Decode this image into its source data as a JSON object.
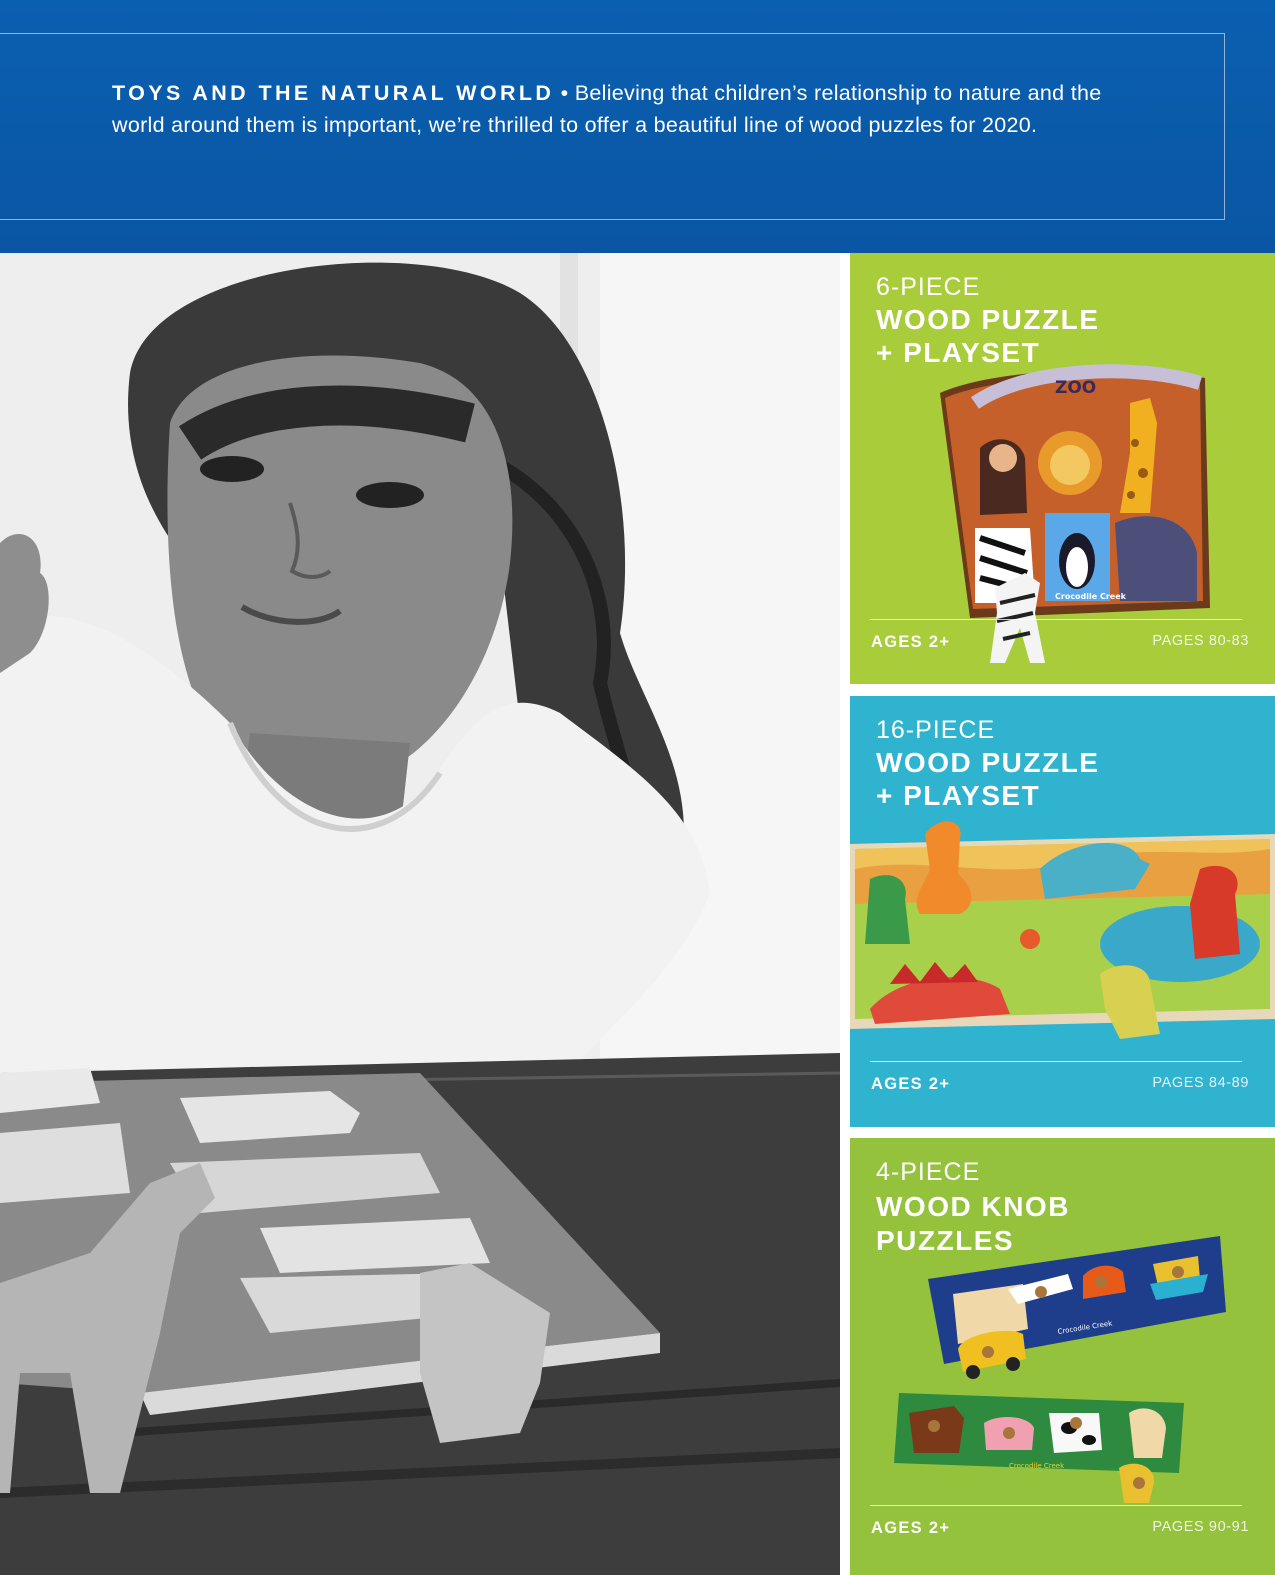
{
  "header": {
    "kicker": "TOYS AND THE NATURAL WORLD",
    "bullet": " • ",
    "body": "Believing that children’s relationship to nature and the world around them is important, we’re thrilled to offer a beautiful line of wood puzzles for 2020."
  },
  "panels": [
    {
      "pieces": "6-PIECE",
      "title_line1": "WOOD PUZZLE",
      "title_line2": "+ PLAYSET",
      "ages": "AGES 2+",
      "pages": "PAGES 80-83",
      "color": "#a8cc3a",
      "product_sign": "ZOO",
      "product_brand": "Crocodile Creek"
    },
    {
      "pieces": "16-PIECE",
      "title_line1": "WOOD PUZZLE",
      "title_line2": "+ PLAYSET",
      "ages": "AGES 2+",
      "pages": "PAGES 84-89",
      "color": "#2fb3cf"
    },
    {
      "pieces": "4-PIECE",
      "title_line1": "WOOD KNOB",
      "title_line2": "PUZZLES",
      "ages": "AGES 2+",
      "pages": "PAGES 90-91",
      "color": "#94c23d",
      "product_brand": "Crocodile Creek"
    }
  ]
}
